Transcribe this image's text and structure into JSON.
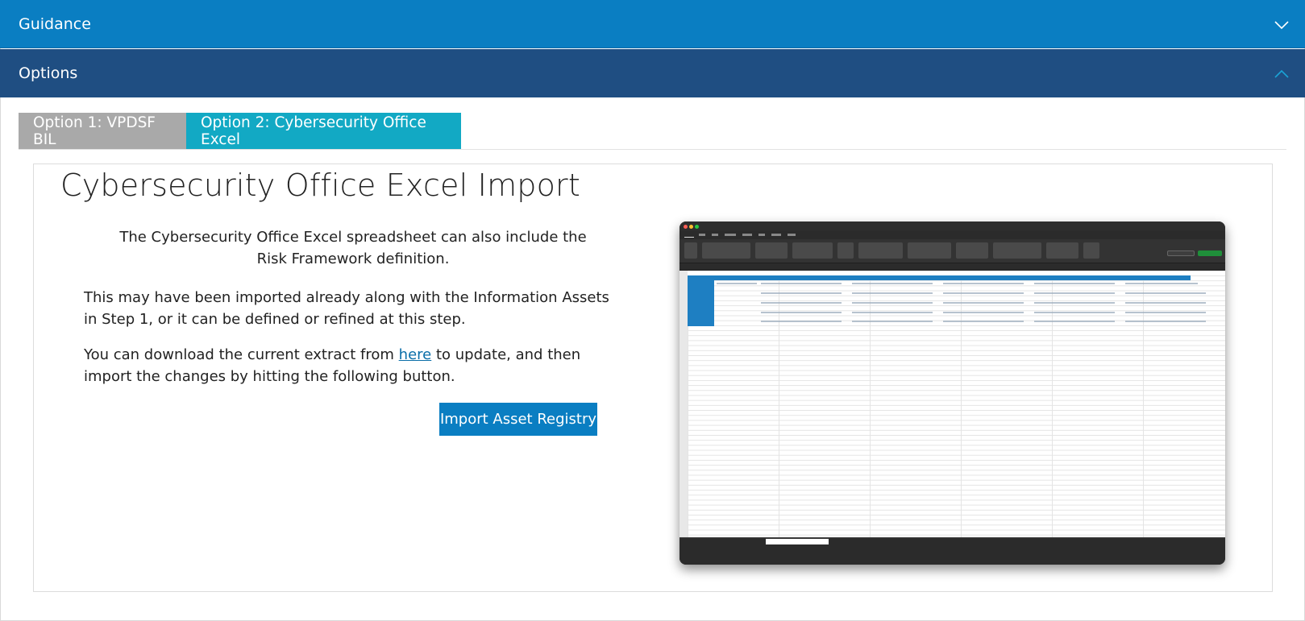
{
  "accordion": {
    "guidance_label": "Guidance",
    "options_label": "Options"
  },
  "tabs": [
    {
      "label": "Option 1: VPDSF BIL",
      "active": false
    },
    {
      "label": "Option 2: Cybersecurity Office Excel",
      "active": true
    }
  ],
  "panel": {
    "title": "Cybersecurity Office Excel Import",
    "paragraph1": "The Cybersecurity Office Excel spreadsheet can also include the Risk Framework definition.",
    "paragraph2": "This may have been imported already along with the Information Assets in Step 1, or it can be defined or refined at this step.",
    "paragraph3_before": "You can download the current extract from ",
    "paragraph3_link": "here",
    "paragraph3_after": " to update, and then import the changes by hitting the following button.",
    "import_button": "Import Asset Registry"
  },
  "colors": {
    "guidance_bar": "#0a7ec2",
    "options_bar": "#1f4e82",
    "tab_inactive": "#a9a9a9",
    "tab_active": "#12a9c4",
    "button": "#0a7ec2",
    "link": "#0a6ea8"
  },
  "icons": {
    "guidance_chevron": "chevron-down-icon",
    "options_chevron": "chevron-up-icon"
  }
}
